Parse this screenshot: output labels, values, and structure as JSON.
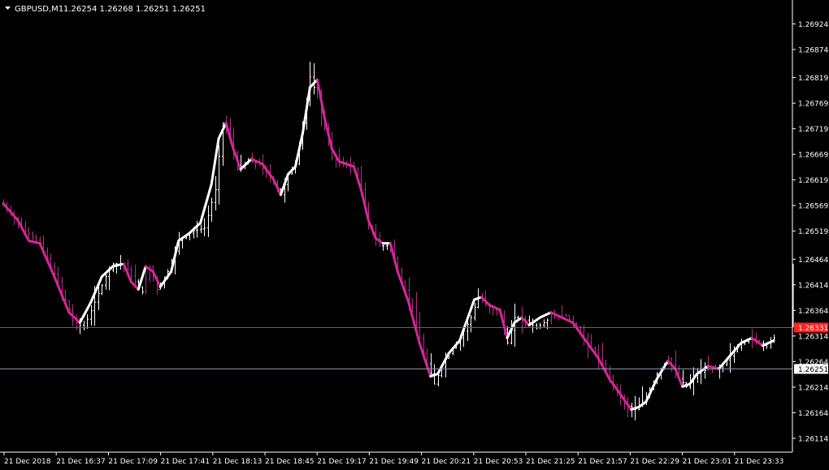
{
  "header": {
    "symbol": "GBPUSD,M1",
    "ohlc": "1.26254 1.26268 1.26251 1.26251"
  },
  "colors": {
    "background": "#000000",
    "foreground": "#ffffff",
    "bar": "#ffffff",
    "ma_up": "#ffffff",
    "ma_down": "#d6249a",
    "hline_red": "#ff2020",
    "hline_bid": "#8a96a8"
  },
  "chart_data": {
    "type": "bar",
    "symbol": "GBPUSD",
    "timeframe": "M1",
    "ylim": [
      1.26098,
      1.26958
    ],
    "y_ticks": [
      "1.26924",
      "1.26874",
      "1.26819",
      "1.26769",
      "1.26719",
      "1.26669",
      "1.26619",
      "1.26569",
      "1.26519",
      "1.26464",
      "1.26414",
      "1.26364",
      "1.26314",
      "1.26264",
      "1.26214",
      "1.26164",
      "1.26114"
    ],
    "x_ticks": [
      "21 Dec 2018",
      "21 Dec 16:37",
      "21 Dec 17:09",
      "21 Dec 17:41",
      "21 Dec 18:13",
      "21 Dec 18:45",
      "21 Dec 19:17",
      "21 Dec 19:49",
      "21 Dec 20:21",
      "21 Dec 20:53",
      "21 Dec 21:25",
      "21 Dec 21:57",
      "21 Dec 22:29",
      "21 Dec 23:01",
      "21 Dec 23:33"
    ],
    "horizontal_lines": [
      {
        "price": 1.26331,
        "label": "1.26331",
        "color": "#ff2020"
      },
      {
        "price": 1.26251,
        "label": "1.26251",
        "color": "#8a96a8"
      }
    ],
    "close_path": [
      [
        0,
        1.2657
      ],
      [
        6,
        1.2652
      ],
      [
        10,
        1.26495
      ],
      [
        15,
        1.2642
      ],
      [
        19,
        1.26345
      ],
      [
        22,
        1.2633
      ],
      [
        25,
        1.2638
      ],
      [
        28,
        1.2643
      ],
      [
        30,
        1.26455
      ],
      [
        33,
        1.26455
      ],
      [
        36,
        1.2642
      ],
      [
        38,
        1.264
      ],
      [
        40,
        1.2645
      ],
      [
        42,
        1.26405
      ],
      [
        45,
        1.2644
      ],
      [
        48,
        1.265
      ],
      [
        52,
        1.2652
      ],
      [
        55,
        1.26525
      ],
      [
        58,
        1.266
      ],
      [
        60,
        1.2673
      ],
      [
        62,
        1.26705
      ],
      [
        64,
        1.2664
      ],
      [
        67,
        1.26655
      ],
      [
        70,
        1.2665
      ],
      [
        73,
        1.26625
      ],
      [
        76,
        1.2659
      ],
      [
        78,
        1.2663
      ],
      [
        80,
        1.2665
      ],
      [
        82,
        1.2673
      ],
      [
        84,
        1.2682
      ],
      [
        86,
        1.2678
      ],
      [
        88,
        1.2672
      ],
      [
        90,
        1.26665
      ],
      [
        92,
        1.26655
      ],
      [
        94,
        1.2665
      ],
      [
        96,
        1.2664
      ],
      [
        98,
        1.266
      ],
      [
        100,
        1.2653
      ],
      [
        103,
        1.2649
      ],
      [
        106,
        1.2649
      ],
      [
        109,
        1.2642
      ],
      [
        112,
        1.2637
      ],
      [
        115,
        1.2628
      ],
      [
        118,
        1.2622
      ],
      [
        121,
        1.2627
      ],
      [
        125,
        1.2631
      ],
      [
        128,
        1.2635
      ],
      [
        130,
        1.2639
      ],
      [
        133,
        1.2637
      ],
      [
        136,
        1.26355
      ],
      [
        138,
        1.263
      ],
      [
        140,
        1.2635
      ],
      [
        143,
        1.26345
      ],
      [
        146,
        1.2633
      ],
      [
        150,
        1.2635
      ],
      [
        154,
        1.26355
      ],
      [
        157,
        1.2633
      ],
      [
        160,
        1.263
      ],
      [
        164,
        1.2626
      ],
      [
        167,
        1.2622
      ],
      [
        170,
        1.2618
      ],
      [
        173,
        1.2617
      ],
      [
        176,
        1.26195
      ],
      [
        179,
        1.2624
      ],
      [
        182,
        1.2627
      ],
      [
        185,
        1.2623
      ],
      [
        187,
        1.26215
      ],
      [
        190,
        1.2624
      ],
      [
        193,
        1.2625
      ],
      [
        196,
        1.2625
      ],
      [
        199,
        1.26275
      ],
      [
        202,
        1.263
      ],
      [
        205,
        1.2631
      ],
      [
        208,
        1.26295
      ],
      [
        211,
        1.2631
      ]
    ],
    "ma_path": [
      [
        0,
        1.26573
      ],
      [
        4,
        1.2654
      ],
      [
        7,
        1.265
      ],
      [
        10,
        1.26495
      ],
      [
        14,
        1.2643
      ],
      [
        18,
        1.2636
      ],
      [
        21,
        1.2634
      ],
      [
        24,
        1.2638
      ],
      [
        27,
        1.2643
      ],
      [
        30,
        1.2645
      ],
      [
        33,
        1.26455
      ],
      [
        35,
        1.2642
      ],
      [
        37,
        1.26405
      ],
      [
        39,
        1.2645
      ],
      [
        41,
        1.2644
      ],
      [
        43,
        1.2641
      ],
      [
        46,
        1.2644
      ],
      [
        48,
        1.265
      ],
      [
        51,
        1.26515
      ],
      [
        54,
        1.26535
      ],
      [
        57,
        1.2661
      ],
      [
        59,
        1.267
      ],
      [
        61,
        1.2673
      ],
      [
        63,
        1.2668
      ],
      [
        65,
        1.2664
      ],
      [
        68,
        1.2666
      ],
      [
        71,
        1.2665
      ],
      [
        74,
        1.2662
      ],
      [
        76,
        1.2659
      ],
      [
        78,
        1.2663
      ],
      [
        80,
        1.26645
      ],
      [
        82,
        1.2671
      ],
      [
        84,
        1.268
      ],
      [
        86,
        1.26815
      ],
      [
        88,
        1.2674
      ],
      [
        90,
        1.2668
      ],
      [
        92,
        1.26655
      ],
      [
        94,
        1.2665
      ],
      [
        96,
        1.26645
      ],
      [
        98,
        1.266
      ],
      [
        100,
        1.2654
      ],
      [
        102,
        1.26505
      ],
      [
        104,
        1.26495
      ],
      [
        106,
        1.26495
      ],
      [
        108,
        1.2644
      ],
      [
        111,
        1.2638
      ],
      [
        114,
        1.263
      ],
      [
        117,
        1.26235
      ],
      [
        119,
        1.2624
      ],
      [
        122,
        1.2628
      ],
      [
        125,
        1.26305
      ],
      [
        127,
        1.26345
      ],
      [
        129,
        1.26385
      ],
      [
        131,
        1.2639
      ],
      [
        133,
        1.26375
      ],
      [
        136,
        1.26365
      ],
      [
        138,
        1.2631
      ],
      [
        140,
        1.2634
      ],
      [
        142,
        1.2635
      ],
      [
        144,
        1.26335
      ],
      [
        147,
        1.2635
      ],
      [
        150,
        1.2636
      ],
      [
        153,
        1.2635
      ],
      [
        156,
        1.2634
      ],
      [
        158,
        1.2632
      ],
      [
        160,
        1.263
      ],
      [
        163,
        1.2627
      ],
      [
        166,
        1.2623
      ],
      [
        169,
        1.262
      ],
      [
        172,
        1.2617
      ],
      [
        174,
        1.26175
      ],
      [
        176,
        1.26185
      ],
      [
        179,
        1.2623
      ],
      [
        182,
        1.26265
      ],
      [
        184,
        1.2625
      ],
      [
        186,
        1.26215
      ],
      [
        188,
        1.2622
      ],
      [
        190,
        1.2624
      ],
      [
        193,
        1.26255
      ],
      [
        196,
        1.2625
      ],
      [
        199,
        1.26275
      ],
      [
        202,
        1.263
      ],
      [
        205,
        1.2631
      ],
      [
        208,
        1.26295
      ],
      [
        211,
        1.26305
      ]
    ],
    "bar_count": 212
  }
}
